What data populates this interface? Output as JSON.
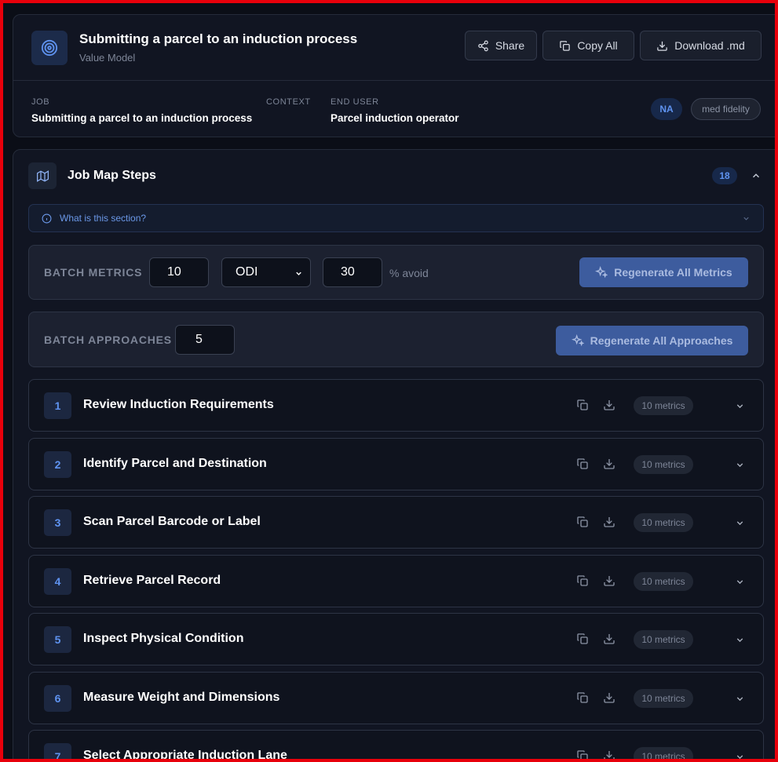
{
  "header": {
    "title": "Submitting a parcel to an induction process",
    "subtitle": "Value Model",
    "share_label": "Share",
    "copy_all_label": "Copy All",
    "download_label": "Download .md"
  },
  "meta": {
    "job_label": "JOB",
    "job_value": "Submitting a parcel to an induction process",
    "context_label": "CONTEXT",
    "end_user_label": "END USER",
    "end_user_value": "Parcel induction operator",
    "badge_na": "NA",
    "badge_fidelity": "med fidelity"
  },
  "section": {
    "title": "Job Map Steps",
    "count": "18",
    "info_text": "What is this section?"
  },
  "batch_metrics": {
    "label": "BATCH METRICS",
    "count_value": "10",
    "type_value": "ODI",
    "avoid_value": "30",
    "avoid_suffix": "% avoid",
    "button_label": "Regenerate All Metrics"
  },
  "batch_approaches": {
    "label": "BATCH APPROACHES",
    "count_value": "5",
    "button_label": "Regenerate All Approaches"
  },
  "steps": [
    {
      "num": "1",
      "title": "Review Induction Requirements",
      "badge": "10 metrics"
    },
    {
      "num": "2",
      "title": "Identify Parcel and Destination",
      "badge": "10 metrics"
    },
    {
      "num": "3",
      "title": "Scan Parcel Barcode or Label",
      "badge": "10 metrics"
    },
    {
      "num": "4",
      "title": "Retrieve Parcel Record",
      "badge": "10 metrics"
    },
    {
      "num": "5",
      "title": "Inspect Physical Condition",
      "badge": "10 metrics"
    },
    {
      "num": "6",
      "title": "Measure Weight and Dimensions",
      "badge": "10 metrics"
    },
    {
      "num": "7",
      "title": "Select Appropriate Induction Lane",
      "badge": "10 metrics"
    }
  ],
  "colors": {
    "frame": "#e8000b",
    "background": "#0b0e17",
    "accent": "#5f93f0",
    "button_primary": "#3d5c9e"
  },
  "icons": {
    "logo": "target-icon",
    "share": "share-icon",
    "copy": "copy-icon",
    "download": "download-icon",
    "section": "map-icon",
    "info": "info-icon",
    "chevron": "chevron-icon",
    "sparkle": "sparkle-icon"
  }
}
